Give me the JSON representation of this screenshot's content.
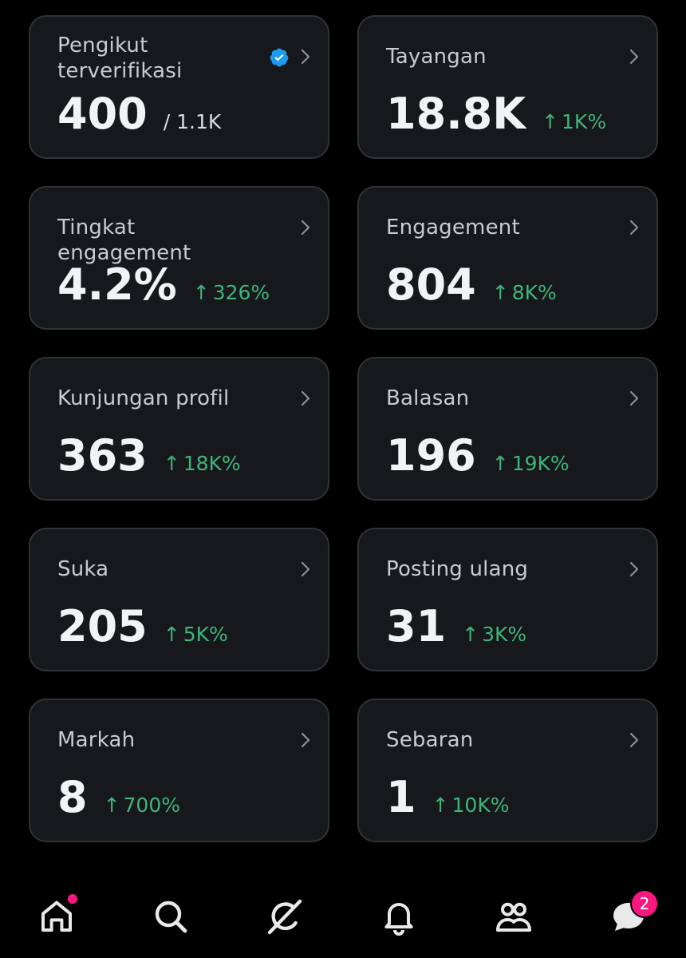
{
  "colors": {
    "background": "#000000",
    "card": "#16181c",
    "positive": "#3fb47a",
    "verified": "#1d9bf0",
    "notification": "#f91880"
  },
  "cards": [
    {
      "title": "Pengikut terverifikasi",
      "value": "400",
      "total": "/ 1.1K",
      "verified_icon": "verified-badge-icon"
    },
    {
      "title": "Tayangan",
      "value": "18.8K",
      "arrow": "↑",
      "change": "1K%"
    },
    {
      "title": "Tingkat engagement",
      "value": "4.2%",
      "arrow": "↑",
      "change": "326%"
    },
    {
      "title": "Engagement",
      "value": "804",
      "arrow": "↑",
      "change": "8K%"
    },
    {
      "title": "Kunjungan profil",
      "value": "363",
      "arrow": "↑",
      "change": "18K%"
    },
    {
      "title": "Balasan",
      "value": "196",
      "arrow": "↑",
      "change": "19K%"
    },
    {
      "title": "Suka",
      "value": "205",
      "arrow": "↑",
      "change": "5K%"
    },
    {
      "title": "Posting ulang",
      "value": "31",
      "arrow": "↑",
      "change": "3K%"
    },
    {
      "title": "Markah",
      "value": "8",
      "arrow": "↑",
      "change": "700%"
    },
    {
      "title": "Sebaran",
      "value": "1",
      "arrow": "↑",
      "change": "10K%"
    }
  ],
  "nav": {
    "items": [
      {
        "icon": "home-icon",
        "has_dot": true
      },
      {
        "icon": "search-icon"
      },
      {
        "icon": "grok-icon"
      },
      {
        "icon": "bell-icon"
      },
      {
        "icon": "communities-icon"
      },
      {
        "icon": "messages-icon",
        "badge": "2"
      }
    ]
  }
}
